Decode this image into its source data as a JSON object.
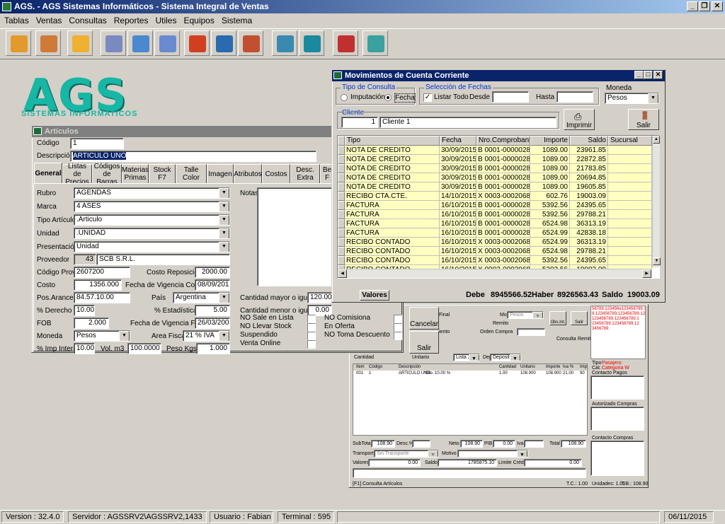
{
  "app": {
    "title": "AGS. - AGS Sistemas Informáticos - Sistema Integral de Ventas"
  },
  "menu": [
    "Tablas",
    "Ventas",
    "Consultas",
    "Reportes",
    "Utiles",
    "Equipos",
    "Sistema"
  ],
  "toolbar": [
    {
      "name": "package-add-icon",
      "color": "#e39a2a"
    },
    {
      "name": "users-icon",
      "color": "#d07a3a"
    },
    {
      "name": "box-icon",
      "color": "#f0b030"
    },
    {
      "name": "cash-register-icon",
      "color": "#7a8ac0"
    },
    {
      "name": "price-tag-icon",
      "color": "#4a88d0"
    },
    {
      "name": "windows-icon",
      "color": "#6a8ad0"
    },
    {
      "name": "pencil-icon",
      "color": "#d04020"
    },
    {
      "name": "book-icon",
      "color": "#2a6ab0"
    },
    {
      "name": "edit-document-icon",
      "color": "#c05030"
    },
    {
      "name": "folder-icon",
      "color": "#3a8ab0"
    },
    {
      "name": "computer-icon",
      "color": "#1a8aa0"
    },
    {
      "name": "tools-icon",
      "color": "#c03030"
    },
    {
      "name": "key-icon",
      "color": "#3aa0a0"
    }
  ],
  "logo": {
    "text": "AGS",
    "sub": "SISTEMAS INFORMATICOS"
  },
  "articulos": {
    "title": "Artículos",
    "codigo_label": "Código",
    "codigo": "1",
    "descripcion_label": "Descripción",
    "descripcion": "ARTICULO UNO",
    "tabs": [
      "General",
      "Listas de Precios",
      "Códigos de Barras",
      "Materias Primas",
      "Stock F7",
      "Talle Color",
      "Imagen",
      "Atributos",
      "Costos",
      "Desc. Extra",
      "Be F"
    ],
    "rubro_label": "Rubro",
    "rubro": "AGENDAS",
    "marca_label": "Marca",
    "marca": "4 ASES",
    "tipo_label": "Tipo Artículo",
    "tipo": ".Articulo",
    "unidad_label": "Unidad",
    "unidad": ".UNIDAD",
    "presentacion_label": "Presentación",
    "presentacion": "Unidad",
    "proveedor_label": "Proveedor",
    "proveedor_num": "43",
    "proveedor": "SCB S.R.L.",
    "codprov_label": "Código Prov.",
    "codprov": "2607200",
    "costorep_label": "Costo Reposición",
    "costorep": "2000.00",
    "costo_label": "Costo",
    "costo": "1356.000",
    "fvc_label": "Fecha de Vigencia Costo",
    "fvc": "08/09/2015",
    "posarance_label": "Pos.Arance.",
    "posarance": "84.57.10.00",
    "pais_label": "País",
    "pais": "Argentina",
    "derecho_label": "% Derecho",
    "derecho": "10.00",
    "estad_label": "% Estadísticas",
    "estad": "5.00",
    "fob_label": "FOB",
    "fob": "2.000",
    "fvfob_label": "Fecha de Vigencia FOB",
    "fvfob": "26/03/2009",
    "moneda_label": "Moneda",
    "moneda": "Pesos",
    "area_label": "Area Fiscal",
    "area": "21 % IVA",
    "impint_label": "% Imp Interno",
    "impint": "10.00",
    "volm3_label": "Vol. m3",
    "volm3": "100.0000",
    "peso_label": "Peso Kgs.",
    "peso": "1.000",
    "notas_label": "Notas",
    "cmay_label": "Cantidad mayor o igual a",
    "cmay": "120.00",
    "cmen_label": "Cantidad menor o igual a",
    "cmen": "0.00",
    "checks": [
      "NO Sale en Lista",
      "NO Llevar Stock",
      "Suspendido",
      "Venta Online"
    ],
    "checks2": [
      "NO Comisiona",
      "En Oferta",
      "NO Toma Descuento"
    ]
  },
  "movimientos": {
    "title": "Movimientos de Cuenta Corriente",
    "tipo_consulta": "Tipo de Consulta",
    "imputacion": "Imputación",
    "fecha": "Fecha",
    "seleccion": "Selección de Fechas",
    "listar": "Listar Todo",
    "desde": "Desde",
    "hasta": "Hasta",
    "moneda_label": "Moneda",
    "moneda": "Pesos",
    "cliente_label": "Cliente",
    "cliente_num": "1",
    "cliente": "Cliente 1",
    "imprimir": "Imprimir",
    "salir": "Salir",
    "columns": [
      "Tipo",
      "Fecha",
      "Nro.Comprobante",
      "Importe",
      "Saldo",
      "Sucursal"
    ],
    "rows": [
      [
        "NOTA DE CREDITO",
        "30/09/2015",
        "B 0001-00000283",
        "1089.00",
        "23961.85"
      ],
      [
        "NOTA DE CREDITO",
        "30/09/2015",
        "B 0001-00000283",
        "1089.00",
        "22872.85"
      ],
      [
        "NOTA DE CREDITO",
        "30/09/2015",
        "B 0001-00000283",
        "1089.00",
        "21783.85"
      ],
      [
        "NOTA DE CREDITO",
        "30/09/2015",
        "B 0001-00000283",
        "1089.00",
        "20694.85"
      ],
      [
        "NOTA DE CREDITO",
        "30/09/2015",
        "B 0001-00000283",
        "1089.00",
        "19605.85"
      ],
      [
        "RECIBO CTA.CTE.",
        "14/10/2015",
        "X 0003-00020682",
        "602.76",
        "19003.09"
      ],
      [
        "FACTURA",
        "16/10/2015",
        "B 0001-00000285",
        "5392.56",
        "24395.65"
      ],
      [
        "FACTURA",
        "16/10/2015",
        "B 0001-00000286",
        "5392.56",
        "29788.21"
      ],
      [
        "FACTURA",
        "16/10/2015",
        "B 0001-00000287",
        "6524.98",
        "36313.19"
      ],
      [
        "FACTURA",
        "16/10/2015",
        "B 0001-00000288",
        "6524.99",
        "42838.18"
      ],
      [
        "RECIBO CONTADO",
        "16/10/2015",
        "X 0003-00020688",
        "6524.99",
        "36313.19"
      ],
      [
        "RECIBO CONTADO",
        "16/10/2015",
        "X 0003-00020687",
        "6524.98",
        "29788.21"
      ],
      [
        "RECIBO CONTADO",
        "16/10/2015",
        "X 0003-00020686",
        "5392.56",
        "24395.65"
      ],
      [
        "RECIBO CONTADO",
        "16/10/2015",
        "X 0003-00020685",
        "5392.56",
        "19003.09"
      ]
    ],
    "valores": "Valores",
    "debe_label": "Debe",
    "debe": "8945566.52",
    "haber_label": "Haber",
    "haber": "8926563.43",
    "saldo_label": "Saldo",
    "saldo": "19003.09"
  },
  "ventas": {
    "cancelar": "Cancelar",
    "salir": "Salir",
    "final": "Final",
    "moneda": "Moneda",
    "pesos": "Pesos",
    "remito": "Remito",
    "orden": "Orden Compra",
    "iento": "iento",
    "obs": "Obs.Int.",
    "salir2": "Salir",
    "consulta": "Consulta",
    "remito2": "Remito",
    "cantidad": "Cantidad",
    "unitario": "Unitario",
    "lista": "Lista 2",
    "dep": "Dep",
    "deposito": "Deposito 0",
    "cols": [
      "Item",
      "Código",
      "Descripción",
      "Cantidad",
      "Unitario",
      "Importe",
      "Iva %",
      "Imp"
    ],
    "row": [
      "001",
      "1",
      "ARTICULO UNO",
      "*Dto. 10.00 %",
      "1.00",
      "108.900",
      "108.900",
      "21.00",
      "90"
    ],
    "red_text": "56789.123456e123456789.12 9.123456789.123456789.12345 123456789.123456789.1 23456789.123456789.12 3456789.",
    "tipo": "Tipo",
    "tipo_val": "Pasajero",
    "cat": "Cat.",
    "cat_val": "Categoria W",
    "contacto_pagos": "Contacto Pagos",
    "autorizado": "Autorizado Compras",
    "contacto_compras": "Contacto Compras",
    "subtotal_label": "SubTotal",
    "subtotal": "108.90",
    "desc_label": "Desc.%",
    "neto_label": "Neto",
    "neto": "108.90",
    "pib_label": "PIB",
    "pib": "0.00",
    "iva_label": "Iva",
    "total_label": "Total",
    "total": "108.90",
    "transporte_label": "Transporte",
    "transporte": "Sin Transporte",
    "motivo_label": "Motivo",
    "valores_label": "Valores",
    "valores": "0.00",
    "saldo_label": "Saldo",
    "saldo": "1785875.10",
    "limite_label": "Limite Crédito",
    "limite": "0.00",
    "f1": "[F1] Consulta Artículos",
    "tc": "T.C.: 1.00",
    "unidades": "Unidades: 1.00",
    "tb": "T.B.: 108.90"
  },
  "status": {
    "version": "Version : 32.4.0",
    "servidor": "Servidor : AGSSRV2\\AGSSRV2,1433",
    "usuario": "Usuario : Fabian",
    "terminal": "Terminal : 595",
    "fecha": "06/11/2015"
  }
}
